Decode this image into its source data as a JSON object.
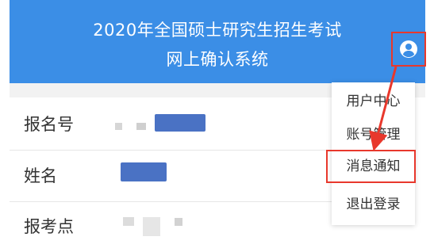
{
  "header": {
    "title_line1": "2020年全国硕士研究生招生考试",
    "title_line2": "网上确认系统",
    "user_icon": "user-circle-icon"
  },
  "info_rows": [
    {
      "label": "报名号"
    },
    {
      "label": "姓名"
    },
    {
      "label": "报考点"
    }
  ],
  "dropdown_menu": {
    "items": [
      {
        "label": "用户中心"
      },
      {
        "label": "账号管理"
      },
      {
        "label": "消息通知"
      },
      {
        "label": "退出登录"
      }
    ],
    "highlighted": "消息通知"
  },
  "colors": {
    "header_bg": "#3b8ee6",
    "annotation_red": "#e8382c",
    "redaction_blue": "#4a72c4"
  }
}
